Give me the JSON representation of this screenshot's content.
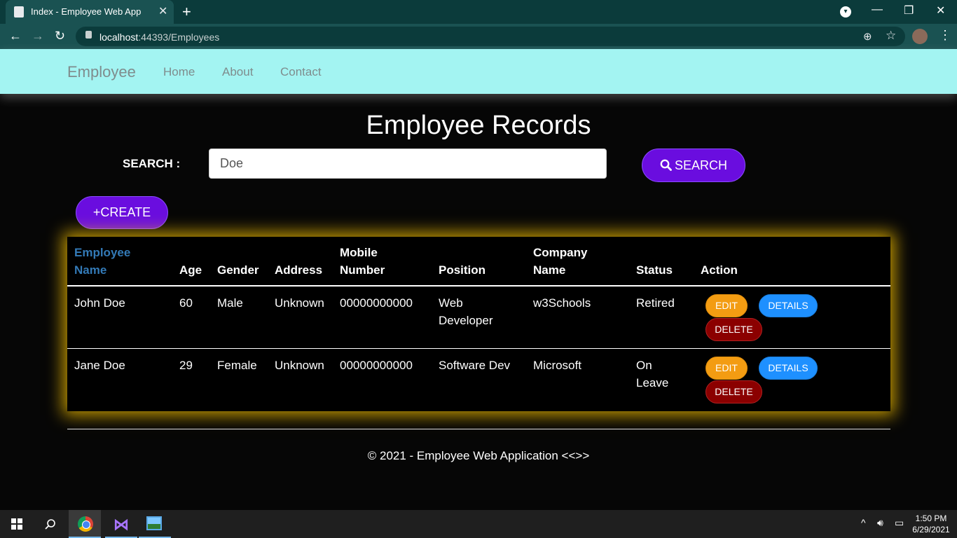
{
  "browser": {
    "tab_title": "Index - Employee Web App",
    "tab_close": "✕",
    "new_tab": "+",
    "url_host": "localhost",
    "url_rest": ":44393/Employees",
    "window_controls": {
      "minimize": "—",
      "restore": "❐",
      "close": "✕"
    }
  },
  "navbar": {
    "brand": "Employee",
    "links": [
      "Home",
      "About",
      "Contact"
    ]
  },
  "page": {
    "title": "Employee Records",
    "search_label": "SEARCH :",
    "search_value": "Doe",
    "search_button": "SEARCH",
    "create_button": "+CREATE"
  },
  "table": {
    "headers": {
      "name_line1": "Employee",
      "name_line2": "Name",
      "age": "Age",
      "gender": "Gender",
      "address": "Address",
      "mobile_line1": "Mobile",
      "mobile_line2": "Number",
      "position": "Position",
      "company_line1": "Company",
      "company_line2": "Name",
      "status": "Status",
      "action": "Action"
    },
    "rows": [
      {
        "name": "John Doe",
        "age": "60",
        "gender": "Male",
        "address": "Unknown",
        "mobile": "00000000000",
        "position_line1": "Web",
        "position_line2": "Developer",
        "company": "w3Schools",
        "status_line1": "Retired",
        "status_line2": "",
        "edit": "EDIT",
        "details": "DETAILS",
        "delete": "DELETE"
      },
      {
        "name": "Jane Doe",
        "age": "29",
        "gender": "Female",
        "address": "Unknown",
        "mobile": "00000000000",
        "position_line1": "Software Dev",
        "position_line2": "",
        "company": "Microsoft",
        "status_line1": "On",
        "status_line2": "Leave",
        "edit": "EDIT",
        "details": "DETAILS",
        "delete": "DELETE"
      }
    ]
  },
  "footer": {
    "text": "© 2021 - Employee Web Application <<>>"
  },
  "taskbar": {
    "time": "1:50 PM",
    "date": "6/29/2021"
  },
  "colors": {
    "navbar_bg": "#a3f4f2",
    "primary_button": "#6a0ddf",
    "edit_button": "#f39c12",
    "details_button": "#1e90ff",
    "delete_button": "#8b0000",
    "table_glow": "#ffc800",
    "sort_header_link": "#337ab7"
  },
  "icons": {
    "search_button_icon": "search-icon",
    "browser_back": "back-arrow-icon",
    "browser_forward": "forward-arrow-icon",
    "browser_reload": "reload-icon",
    "address_lock": "lock-icon",
    "address_zoom": "zoom-icon",
    "address_bookmark": "star-icon"
  }
}
